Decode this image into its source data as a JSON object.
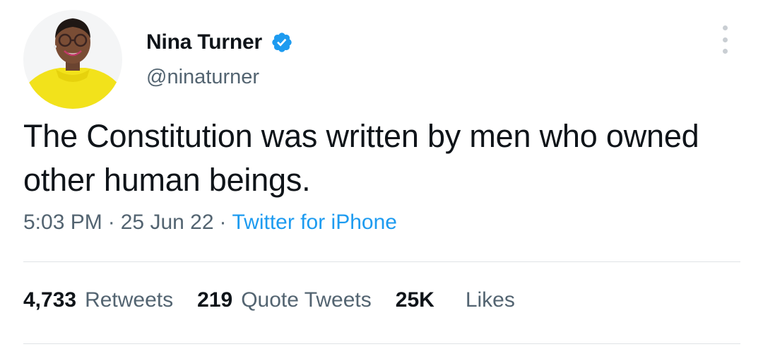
{
  "author": {
    "display_name": "Nina Turner",
    "handle": "@ninaturner",
    "verified": true,
    "avatar_icon": "profile-photo"
  },
  "tweet": {
    "text": "The Constitution was written by men who owned other human beings.",
    "time": "5:03 PM",
    "separator": "·",
    "date": "25 Jun 22",
    "source": "Twitter for iPhone"
  },
  "stats": {
    "retweets_count": "4,733",
    "retweets_label": "Retweets",
    "quote_tweets_count": "219",
    "quote_tweets_label": "Quote Tweets",
    "likes_count": "25K",
    "likes_label": "Likes"
  },
  "colors": {
    "text_primary": "#0f1419",
    "text_secondary": "#536471",
    "link": "#1d9bf0",
    "verified_badge": "#1d9bf0",
    "divider": "#dfe3e6"
  }
}
